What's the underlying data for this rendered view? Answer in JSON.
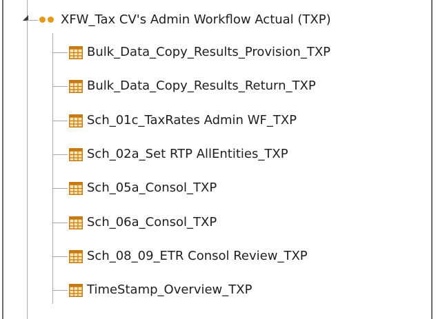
{
  "tree": {
    "root": {
      "label": "XFW_Tax CV's Admin Workflow Actual (TXP)",
      "icon": "workflow-dots-icon",
      "expanded": true
    },
    "children": [
      {
        "label": "Bulk_Data_Copy_Results_Provision_TXP",
        "icon": "table-icon"
      },
      {
        "label": "Bulk_Data_Copy_Results_Return_TXP",
        "icon": "table-icon"
      },
      {
        "label": "Sch_01c_TaxRates Admin WF_TXP",
        "icon": "table-icon"
      },
      {
        "label": "Sch_02a_Set RTP AllEntities_TXP",
        "icon": "table-icon"
      },
      {
        "label": "Sch_05a_Consol_TXP",
        "icon": "table-icon"
      },
      {
        "label": "Sch_06a_Consol_TXP",
        "icon": "table-icon"
      },
      {
        "label": "Sch_08_09_ETR Consol Review_TXP",
        "icon": "table-icon"
      },
      {
        "label": "TimeStamp_Overview_TXP",
        "icon": "table-icon"
      }
    ]
  },
  "colors": {
    "dot": "#e39b1c",
    "table_border": "#c77a12",
    "table_fill": "#fde8b8",
    "guide": "#a8a8a8",
    "text": "#1e1e1e"
  }
}
